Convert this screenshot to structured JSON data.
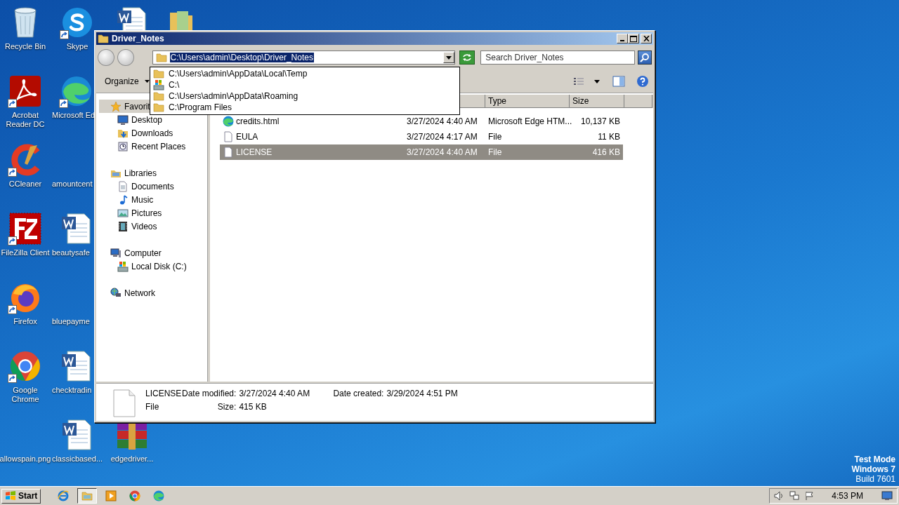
{
  "desktop": {
    "icons": [
      {
        "kind": "recycle",
        "label": "Recycle Bin",
        "shortcut": false
      },
      {
        "kind": "pdf",
        "label": "Acrobat Reader DC",
        "shortcut": true
      },
      {
        "kind": "ccleaner",
        "label": "CCleaner",
        "shortcut": true
      },
      {
        "kind": "filezilla",
        "label": "FileZilla Client",
        "shortcut": true
      },
      {
        "kind": "firefox",
        "label": "Firefox",
        "shortcut": true
      },
      {
        "kind": "chrome",
        "label": "Google Chrome",
        "shortcut": true
      },
      {
        "kind": "blank",
        "label": "allowspain.png"
      },
      {
        "kind": "skype",
        "label": "Skype",
        "shortcut": true
      },
      {
        "kind": "edge",
        "label": "Microsoft Ed",
        "shortcut": true
      },
      {
        "kind": "blank",
        "label": "amountcent"
      },
      {
        "kind": "word",
        "label": "beautysafe",
        "shortcut": false
      },
      {
        "kind": "blank",
        "label": "bluepayme"
      },
      {
        "kind": "word",
        "label": "checktradin",
        "shortcut": false
      },
      {
        "kind": "word",
        "label": "classicbased...",
        "shortcut": false
      },
      {
        "kind": "word",
        "shortcut": false
      },
      {
        "kind": "winrar",
        "label": "edgedriver...",
        "shortcut": false
      },
      {
        "kind": "folder",
        "shortcut": false
      }
    ]
  },
  "window": {
    "title": "Driver_Notes",
    "address": {
      "value": "C:\\Users\\admin\\Desktop\\Driver_Notes",
      "highlighted": true,
      "history": [
        {
          "kind": "folder",
          "path": "C:\\Users\\admin\\AppData\\Local\\Temp"
        },
        {
          "kind": "drive",
          "path": "C:\\"
        },
        {
          "kind": "folder",
          "path": "C:\\Users\\admin\\AppData\\Roaming"
        },
        {
          "kind": "folder",
          "path": "C:\\Program Files"
        }
      ]
    },
    "search": {
      "placeholder": "Search Driver_Notes"
    },
    "organize": "Organize",
    "nav": [
      {
        "kind": "star",
        "label": "Favorit",
        "selected": true,
        "children": [
          {
            "kind": "desktop",
            "label": "Desktop",
            "selected": false
          },
          {
            "kind": "downloads",
            "label": "Downloads",
            "selected": false
          },
          {
            "kind": "recent",
            "label": "Recent Places",
            "selected": false
          }
        ]
      },
      {
        "kind": "libraries",
        "label": "Libraries",
        "selected": false,
        "children": [
          {
            "kind": "documents",
            "label": "Documents",
            "selected": false
          },
          {
            "kind": "music",
            "label": "Music",
            "selected": false
          },
          {
            "kind": "pictures",
            "label": "Pictures",
            "selected": false
          },
          {
            "kind": "videos",
            "label": "Videos",
            "selected": false
          }
        ]
      },
      {
        "kind": "computer",
        "label": "Computer",
        "selected": false,
        "children": [
          {
            "kind": "disk",
            "label": "Local Disk (C:)",
            "selected": false
          }
        ]
      },
      {
        "kind": "network",
        "label": "Network",
        "selected": false
      }
    ],
    "columns": [
      "Type",
      "Size"
    ],
    "files": [
      {
        "kind": "edge",
        "name": "credits.html",
        "date": "3/27/2024 4:40 AM",
        "type": "Microsoft Edge HTM...",
        "size": "10,137 KB",
        "selected": false
      },
      {
        "kind": "file",
        "name": "EULA",
        "date": "3/27/2024 4:17 AM",
        "type": "File",
        "size": "11 KB",
        "selected": false
      },
      {
        "kind": "file",
        "name": "LICENSE",
        "date": "3/27/2024 4:40 AM",
        "type": "File",
        "size": "416 KB",
        "selected": true
      }
    ],
    "details": {
      "name": "LICENSE",
      "type": "File",
      "fields": [
        {
          "label": "Date modified:",
          "value": "3/27/2024 4:40 AM"
        },
        {
          "label": "Date created:",
          "value": "3/29/2024 4:51 PM"
        },
        {
          "label": "Size:",
          "value": "415 KB"
        }
      ]
    }
  },
  "taskbar": {
    "start": "Start",
    "apps": [
      {
        "kind": "ie",
        "active": false
      },
      {
        "kind": "explorer",
        "active": true
      },
      {
        "kind": "media",
        "active": false
      },
      {
        "kind": "chrome",
        "active": false
      },
      {
        "kind": "edge",
        "active": false
      }
    ],
    "time": "4:53 PM"
  },
  "watermark_lines": [
    "Test Mode",
    "Windows 7",
    "Build 7601"
  ]
}
